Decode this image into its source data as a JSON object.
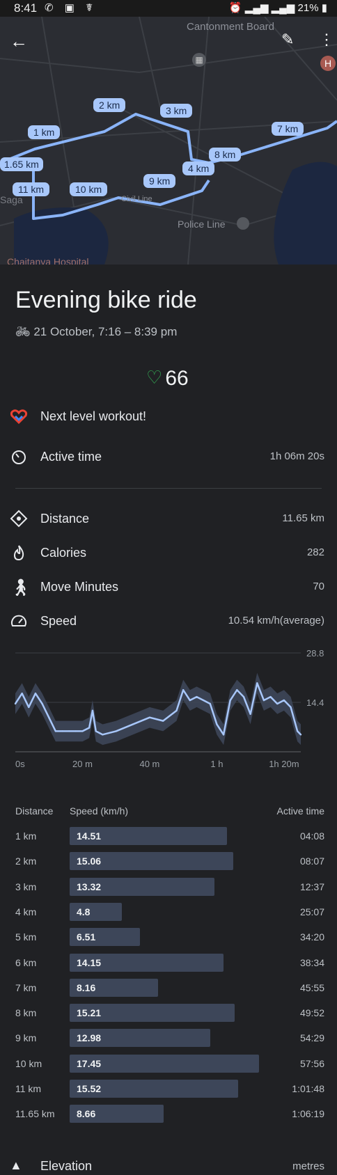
{
  "status": {
    "time": "8:41",
    "battery": "21%"
  },
  "map": {
    "place_top": "Cantonment Board",
    "place_bottom_left": "Chaitanya Hospital",
    "place_police": "Police Line",
    "place_left": "Saga",
    "place_civil": "Civil Line",
    "markers": [
      "1 km",
      "2 km",
      "3 km",
      "4 km",
      "7 km",
      "8 km",
      "9 km",
      "10 km",
      "11 km",
      "1.65 km"
    ]
  },
  "activity": {
    "title": "Evening bike ride",
    "date": "21 October, 7:16 – 8:39 pm",
    "heart_points": "66",
    "goal_msg": "Next level workout!"
  },
  "stats": {
    "active_time_label": "Active time",
    "active_time_value": "1h 06m 20s",
    "distance_label": "Distance",
    "distance_value": "11.65 km",
    "calories_label": "Calories",
    "calories_value": "282",
    "move_label": "Move Minutes",
    "move_value": "70",
    "speed_label": "Speed",
    "speed_value": "10.54 km/h(average)"
  },
  "chart_data": {
    "type": "line",
    "title": "",
    "xlabel": "",
    "ylabel": "",
    "x_ticks": [
      "0s",
      "20 m",
      "40 m",
      "1 h",
      "1h 20m"
    ],
    "y_ticks": [
      "28.8",
      "14.4"
    ],
    "ylim": [
      0,
      28.8
    ],
    "series": [
      {
        "x": [
          0,
          2,
          4,
          6,
          8,
          10,
          12,
          14,
          16,
          18,
          20,
          22,
          23,
          24,
          26,
          30,
          35,
          40,
          44,
          48,
          50,
          52,
          54,
          56,
          58,
          60,
          62,
          64,
          66,
          68,
          70,
          72,
          74,
          76,
          78,
          80,
          82,
          84,
          85
        ],
        "values": [
          14,
          17,
          13,
          17,
          14,
          10,
          6,
          6,
          6,
          6,
          6,
          7,
          12,
          6,
          5,
          6,
          8,
          10,
          9,
          12,
          18,
          15,
          16,
          15,
          14,
          8,
          5,
          15,
          18,
          16,
          11,
          20,
          15,
          16,
          14,
          15,
          13,
          6,
          5
        ]
      }
    ]
  },
  "table": {
    "headers": {
      "distance": "Distance",
      "speed": "Speed (km/h)",
      "time": "Active time"
    },
    "rows": [
      {
        "d": "1 km",
        "s": "14.51",
        "t": "04:08",
        "v": 14.51
      },
      {
        "d": "2 km",
        "s": "15.06",
        "t": "08:07",
        "v": 15.06
      },
      {
        "d": "3 km",
        "s": "13.32",
        "t": "12:37",
        "v": 13.32
      },
      {
        "d": "4 km",
        "s": "4.8",
        "t": "25:07",
        "v": 4.8
      },
      {
        "d": "5 km",
        "s": "6.51",
        "t": "34:20",
        "v": 6.51
      },
      {
        "d": "6 km",
        "s": "14.15",
        "t": "38:34",
        "v": 14.15
      },
      {
        "d": "7 km",
        "s": "8.16",
        "t": "45:55",
        "v": 8.16
      },
      {
        "d": "8 km",
        "s": "15.21",
        "t": "49:52",
        "v": 15.21
      },
      {
        "d": "9 km",
        "s": "12.98",
        "t": "54:29",
        "v": 12.98
      },
      {
        "d": "10 km",
        "s": "17.45",
        "t": "57:56",
        "v": 17.45
      },
      {
        "d": "11 km",
        "s": "15.52",
        "t": "1:01:48",
        "v": 15.52
      },
      {
        "d": "11.65 km",
        "s": "8.66",
        "t": "1:06:19",
        "v": 8.66
      }
    ]
  },
  "elevation": {
    "label": "Elevation",
    "unit": "metres"
  }
}
